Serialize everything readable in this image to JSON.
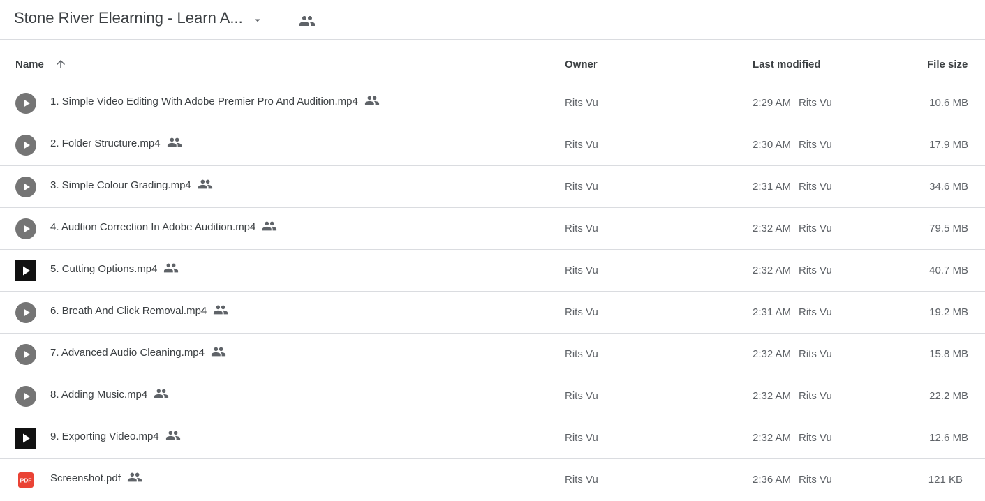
{
  "header": {
    "folder_title": "Stone River Elearning - Learn A...",
    "dropdown_icon": "arrow-drop-down-icon",
    "shared_icon": "people-icon"
  },
  "columns": {
    "name": "Name",
    "owner": "Owner",
    "last_modified": "Last modified",
    "file_size": "File size",
    "sort_icon": "arrow-up-icon"
  },
  "colors": {
    "text": "#3c4043",
    "secondary_text": "#5f6368",
    "divider": "#dadce0",
    "video_icon": "#757575",
    "pdf_icon": "#ea4335"
  },
  "files": [
    {
      "name": "1. Simple Video Editing With Adobe Premier Pro And Audition.mp4",
      "icon": "video-play-icon",
      "owner": "Rits Vu",
      "modified_time": "2:29 AM",
      "modified_by": "Rits Vu",
      "size": "10.6 MB"
    },
    {
      "name": "2. Folder Structure.mp4",
      "icon": "video-play-icon",
      "owner": "Rits Vu",
      "modified_time": "2:30 AM",
      "modified_by": "Rits Vu",
      "size": "17.9 MB"
    },
    {
      "name": "3. Simple Colour Grading.mp4",
      "icon": "video-play-icon",
      "owner": "Rits Vu",
      "modified_time": "2:31 AM",
      "modified_by": "Rits Vu",
      "size": "34.6 MB"
    },
    {
      "name": "4. Audtion Correction In Adobe Audition.mp4",
      "icon": "video-play-icon",
      "owner": "Rits Vu",
      "modified_time": "2:32 AM",
      "modified_by": "Rits Vu",
      "size": "79.5 MB"
    },
    {
      "name": "5. Cutting Options.mp4",
      "icon": "video-thumbnail-icon",
      "owner": "Rits Vu",
      "modified_time": "2:32 AM",
      "modified_by": "Rits Vu",
      "size": "40.7 MB"
    },
    {
      "name": "6. Breath And Click Removal.mp4",
      "icon": "video-play-icon",
      "owner": "Rits Vu",
      "modified_time": "2:31 AM",
      "modified_by": "Rits Vu",
      "size": "19.2 MB"
    },
    {
      "name": "7. Advanced Audio Cleaning.mp4",
      "icon": "video-play-icon",
      "owner": "Rits Vu",
      "modified_time": "2:32 AM",
      "modified_by": "Rits Vu",
      "size": "15.8 MB"
    },
    {
      "name": "8. Adding Music.mp4",
      "icon": "video-play-icon",
      "owner": "Rits Vu",
      "modified_time": "2:32 AM",
      "modified_by": "Rits Vu",
      "size": "22.2 MB"
    },
    {
      "name": "9. Exporting Video.mp4",
      "icon": "video-thumbnail-icon",
      "owner": "Rits Vu",
      "modified_time": "2:32 AM",
      "modified_by": "Rits Vu",
      "size": "12.6 MB"
    },
    {
      "name": "Screenshot.pdf",
      "icon": "pdf-icon",
      "icon_label": "PDF",
      "owner": "Rits Vu",
      "modified_time": "2:36 AM",
      "modified_by": "Rits Vu",
      "size": "121 KB"
    }
  ]
}
